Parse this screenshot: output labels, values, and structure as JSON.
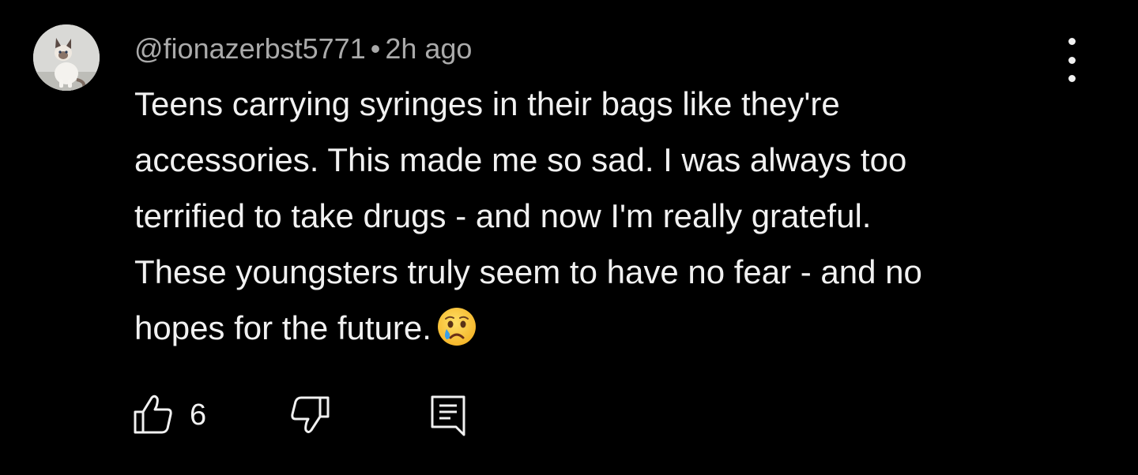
{
  "comment": {
    "author": "@fionazerbst5771",
    "separator": "•",
    "time": "2h ago",
    "text_lines": [
      "Teens carrying syringes in their bags like they're",
      "accessories. This made me so sad. I was always too",
      "terrified to take drugs - and now I'm really grateful.",
      "These youngsters truly seem to have no fear - and no",
      "hopes for the future."
    ],
    "emoji": "crying-face",
    "like_count": "6"
  },
  "icons": {
    "avatar": "cat-avatar",
    "more": "more-vert-icon",
    "like": "thumbs-up-icon",
    "dislike": "thumbs-down-icon",
    "reply": "comment-reply-icon"
  },
  "colors": {
    "background": "#000000",
    "text": "#f1f1f1",
    "meta": "#aaaaaa"
  }
}
